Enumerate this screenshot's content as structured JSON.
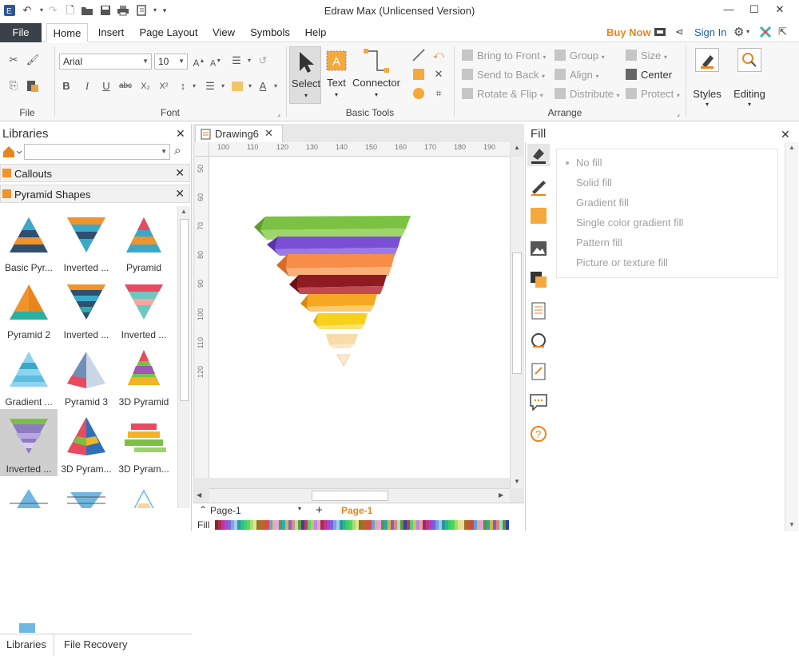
{
  "app": {
    "title": "Edraw Max (Unlicensed Version)"
  },
  "menu": {
    "file": "File",
    "tabs": [
      "Home",
      "Insert",
      "Page Layout",
      "View",
      "Symbols",
      "Help"
    ],
    "buy_now": "Buy Now",
    "sign_in": "Sign In"
  },
  "ribbon": {
    "font_name": "Arial",
    "font_size": "10",
    "groups": {
      "file": "File",
      "font": "Font",
      "basic_tools": "Basic Tools",
      "arrange": "Arrange"
    },
    "tools": {
      "select": "Select",
      "text": "Text",
      "connector": "Connector"
    },
    "arrange": {
      "bring_to_front": "Bring to Front",
      "send_to_back": "Send to Back",
      "rotate_flip": "Rotate & Flip",
      "group": "Group",
      "align": "Align",
      "distribute": "Distribute",
      "size": "Size",
      "center": "Center",
      "protect": "Protect"
    },
    "styles": "Styles",
    "editing": "Editing"
  },
  "libraries": {
    "title": "Libraries",
    "sections": [
      "Callouts",
      "Pyramid Shapes"
    ],
    "shapes": [
      "Basic Pyr...",
      "Inverted ...",
      "Pyramid",
      "Pyramid 2",
      "Inverted ...",
      "Inverted ...",
      "Gradient ...",
      "Pyramid 3",
      "3D Pyramid",
      "Inverted ...",
      "3D Pyram...",
      "3D Pyram..."
    ],
    "bottom_tabs": [
      "Libraries",
      "File Recovery"
    ]
  },
  "document": {
    "tab": "Drawing6",
    "ruler_h": [
      "100",
      "110",
      "120",
      "130",
      "140",
      "150",
      "160",
      "170",
      "180",
      "190"
    ],
    "ruler_v": [
      "50",
      "60",
      "70",
      "80",
      "90",
      "100",
      "110",
      "120"
    ],
    "page_selector": "Page-1",
    "active_page": "Page-1",
    "colorbar_label": "Fill"
  },
  "fill": {
    "title": "Fill",
    "options": [
      "No fill",
      "Solid fill",
      "Gradient fill",
      "Single color gradient fill",
      "Pattern fill",
      "Picture or texture fill"
    ]
  },
  "colors": {
    "accent_orange": "#e8861c",
    "file_tab_bg": "#3b4149",
    "link_blue": "#1d5ea8"
  }
}
